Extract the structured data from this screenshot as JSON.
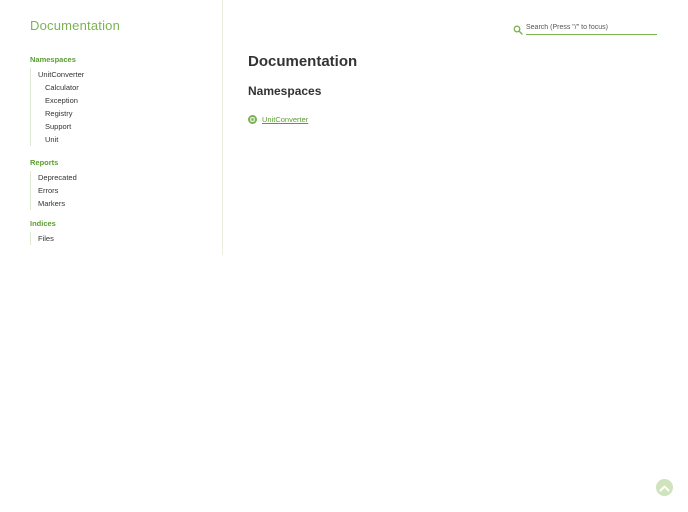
{
  "sidebar": {
    "brand": "Documentation",
    "sections": [
      {
        "title": "Namespaces",
        "items": [
          {
            "label": "UnitConverter"
          },
          {
            "label": "Calculator"
          },
          {
            "label": "Exception"
          },
          {
            "label": "Registry"
          },
          {
            "label": "Support"
          },
          {
            "label": "Unit"
          }
        ]
      },
      {
        "title": "Reports",
        "items": [
          {
            "label": "Deprecated"
          },
          {
            "label": "Errors"
          },
          {
            "label": "Markers"
          }
        ]
      },
      {
        "title": "Indices",
        "items": [
          {
            "label": "Files"
          }
        ]
      }
    ]
  },
  "search": {
    "placeholder": "Search (Press \"/\" to focus)",
    "value": "",
    "icon": "search-icon"
  },
  "main": {
    "title": "Documentation",
    "subtitle": "Namespaces",
    "namespaces": [
      {
        "label": "UnitConverter",
        "icon": "namespace-icon"
      }
    ]
  },
  "back_to_top": {
    "icon": "chevron-up-icon"
  },
  "colors": {
    "accent": "#7bb352",
    "accent_dark": "#5a9e2f",
    "text": "#333333"
  }
}
